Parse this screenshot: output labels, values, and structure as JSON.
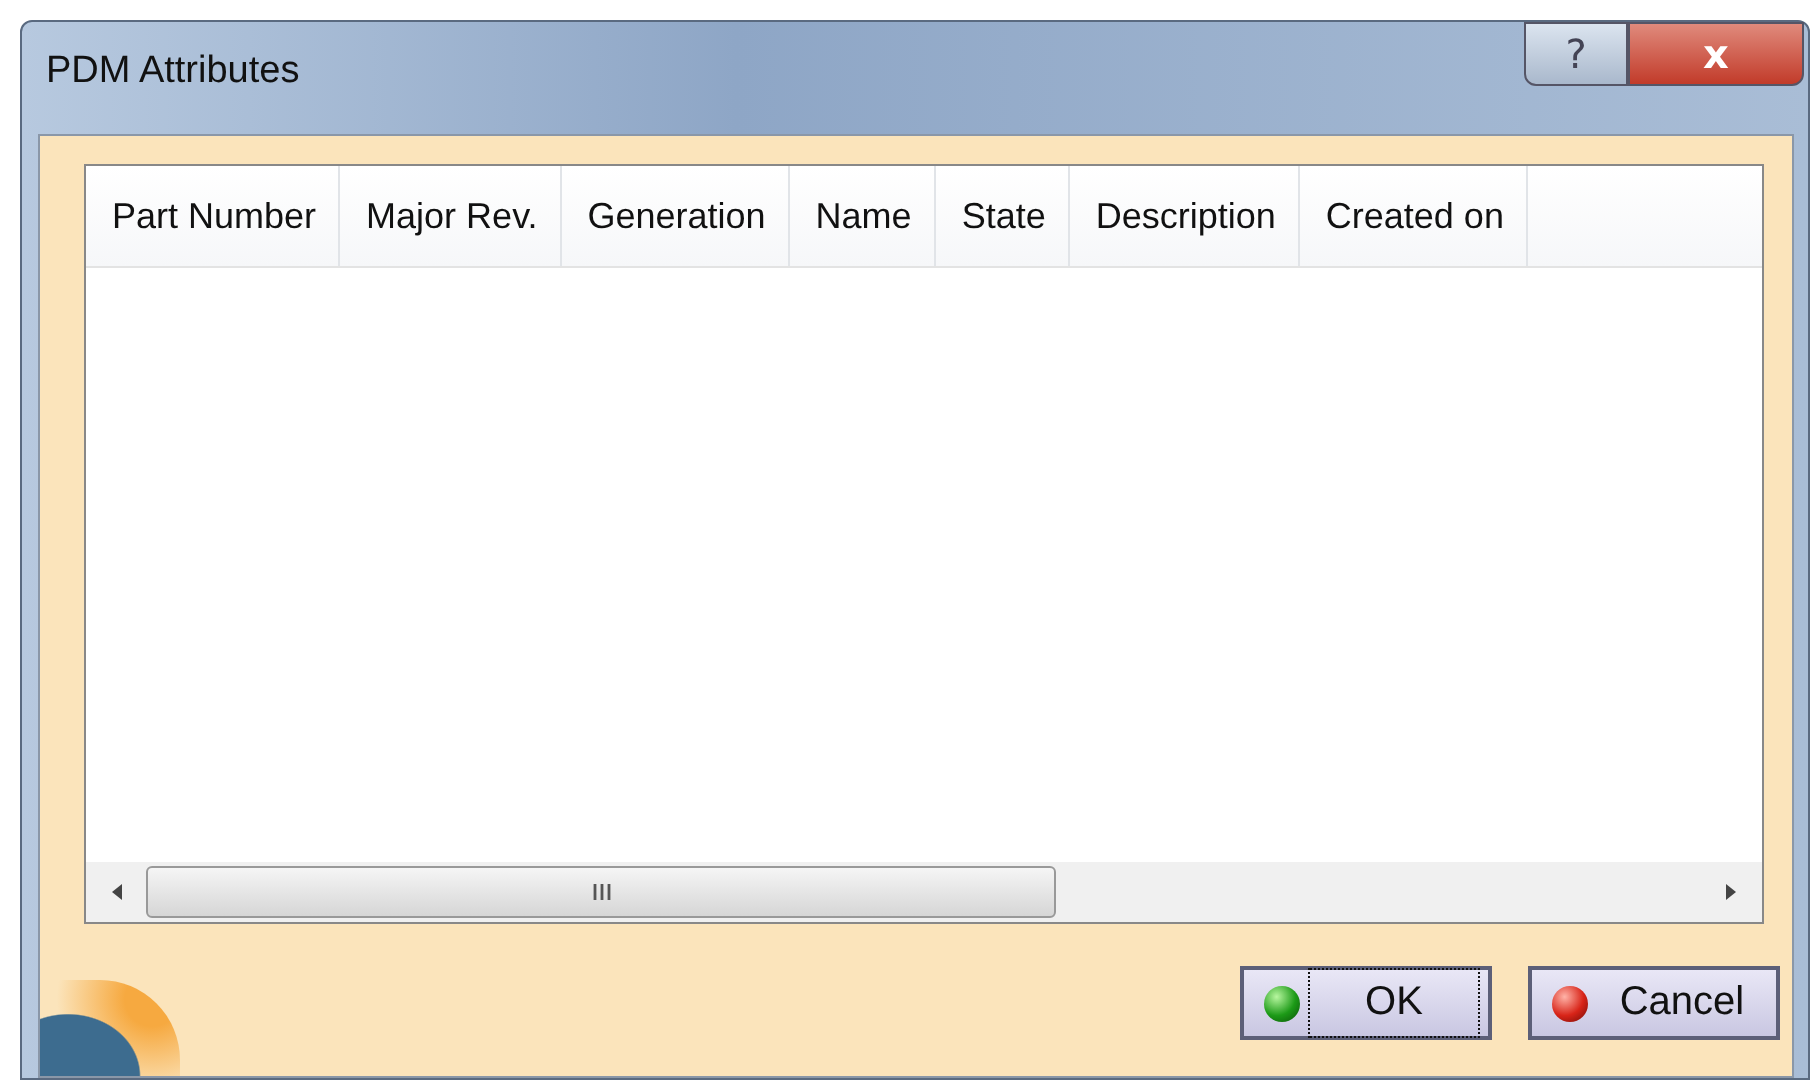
{
  "window": {
    "title": "PDM Attributes",
    "help_glyph": "?",
    "close_glyph": "x"
  },
  "table": {
    "columns": [
      "Part Number",
      "Major Rev.",
      "Generation",
      "Name",
      "State",
      "Description",
      "Created on"
    ]
  },
  "buttons": [
    {
      "label": "OK",
      "kind": "ok",
      "focused": true
    },
    {
      "label": "Cancel",
      "kind": "cancel",
      "focused": false
    }
  ]
}
